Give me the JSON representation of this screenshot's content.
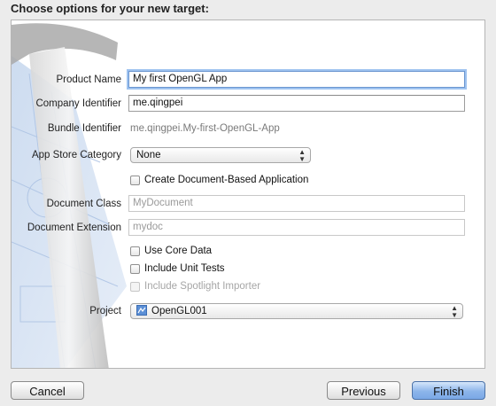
{
  "dialog": {
    "title": "Choose options for your new target:"
  },
  "form": {
    "product_name": {
      "label": "Product Name",
      "value": "My first OpenGL App"
    },
    "company_identifier": {
      "label": "Company Identifier",
      "value": "me.qingpei"
    },
    "bundle_identifier": {
      "label": "Bundle Identifier",
      "value": "me.qingpei.My-first-OpenGL-App"
    },
    "app_store_category": {
      "label": "App Store Category",
      "value": "None"
    },
    "document_based": {
      "label": "Create Document-Based Application",
      "checked": false
    },
    "document_class": {
      "label": "Document Class",
      "placeholder": "MyDocument"
    },
    "document_extension": {
      "label": "Document Extension",
      "placeholder": "mydoc"
    },
    "use_core_data": {
      "label": "Use Core Data",
      "checked": false
    },
    "include_unit_tests": {
      "label": "Include Unit Tests",
      "checked": false
    },
    "include_spotlight_importer": {
      "label": "Include Spotlight Importer",
      "checked": false,
      "enabled": false
    },
    "project": {
      "label": "Project",
      "value": "OpenGL001"
    }
  },
  "buttons": {
    "cancel": "Cancel",
    "previous": "Previous",
    "finish": "Finish"
  },
  "colors": {
    "accent": "#7aa8e6",
    "focus_ring": "#9fc3f0"
  }
}
